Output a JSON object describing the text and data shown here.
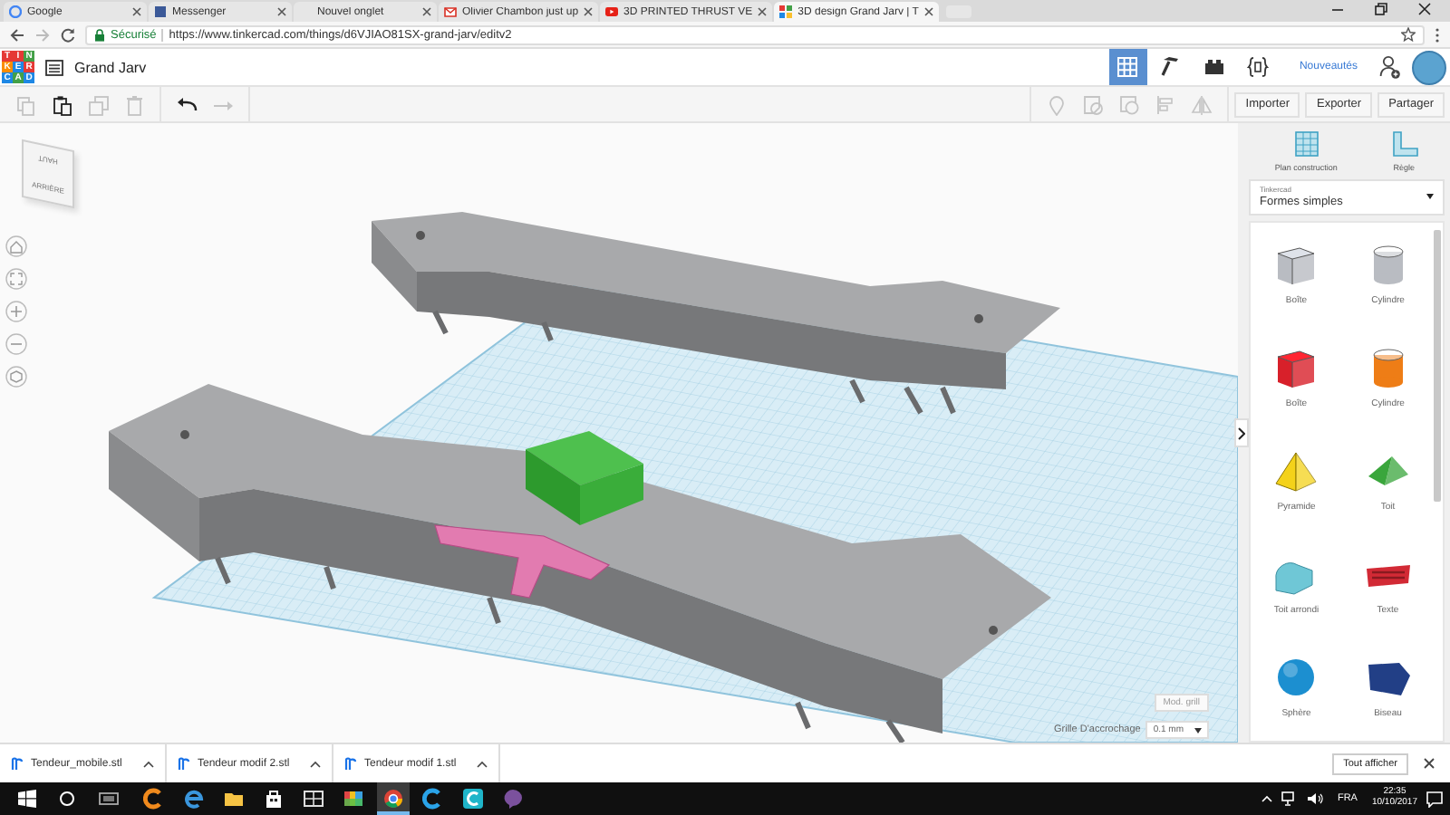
{
  "browser": {
    "tabs": [
      {
        "kind": "google",
        "title": "Google",
        "selected": false
      },
      {
        "kind": "facebook",
        "title": "Messenger",
        "selected": false
      },
      {
        "kind": "blank",
        "title": "Nouvel onglet",
        "selected": false
      },
      {
        "kind": "gmail",
        "title": "Olivier Chambon just up",
        "selected": false
      },
      {
        "kind": "youtube",
        "title": "3D PRINTED THRUST VE",
        "selected": false
      },
      {
        "kind": "tinkercad",
        "title": "3D design Grand Jarv | T",
        "selected": true
      }
    ],
    "secure_label": "Sécurisé",
    "url": "https://www.tinkercad.com/things/d6VJIAO81SX-grand-jarv/editv2"
  },
  "app_header": {
    "logo": [
      "T",
      "I",
      "N",
      "K",
      "E",
      "R",
      "C",
      "A",
      "D"
    ],
    "title": "Grand Jarv",
    "views": [
      {
        "kind": "grid",
        "selected": true
      },
      {
        "kind": "hammer",
        "selected": false
      },
      {
        "kind": "bricks",
        "selected": false
      },
      {
        "kind": "code",
        "selected": false
      }
    ],
    "news": "Nouveautés"
  },
  "toolbar": {
    "edit_tools": [
      {
        "kind": "copy",
        "disabled": true
      },
      {
        "kind": "paste",
        "disabled": false
      },
      {
        "kind": "duplicate",
        "disabled": true
      },
      {
        "kind": "delete",
        "disabled": true
      },
      {
        "kind": "undo",
        "disabled": false
      },
      {
        "kind": "redo",
        "disabled": true
      }
    ],
    "shape_tools": [
      {
        "kind": "pin",
        "disabled": true
      },
      {
        "kind": "note",
        "disabled": true
      },
      {
        "kind": "group",
        "disabled": true
      },
      {
        "kind": "align",
        "disabled": true
      },
      {
        "kind": "mirror",
        "disabled": true
      }
    ],
    "actions": [
      "Importer",
      "Exporter",
      "Partager"
    ]
  },
  "view_cube": {
    "top": "HAUT",
    "front": "ARRIÈRE"
  },
  "snap": {
    "edit_grid": "Mod. grill",
    "label": "Grille D'accrochage",
    "value": "0.1 mm"
  },
  "sidebar": {
    "tools": [
      {
        "kind": "workplane",
        "label": "Plan construction"
      },
      {
        "kind": "ruler",
        "label": "Règle"
      }
    ],
    "library": {
      "label": "Tinkercad",
      "value": "Formes simples"
    },
    "shapes": [
      {
        "kind": "box",
        "label": "Boîte",
        "color": "#b9bcc2"
      },
      {
        "kind": "cylinder",
        "label": "Cylindre",
        "color": "#b9bcc2"
      },
      {
        "kind": "box",
        "label": "Boîte",
        "color": "#d8202a"
      },
      {
        "kind": "cylinder",
        "label": "Cylindre",
        "color": "#ee7d16"
      },
      {
        "kind": "pyramid",
        "label": "Pyramide",
        "color": "#f4d21a"
      },
      {
        "kind": "roof",
        "label": "Toit",
        "color": "#3aa63c"
      },
      {
        "kind": "round-roof",
        "label": "Toit arrondi",
        "color": "#6fc7d6"
      },
      {
        "kind": "text",
        "label": "Texte",
        "color": "#d22a35"
      },
      {
        "kind": "sphere",
        "label": "Sphère",
        "color": "#1c8fd0"
      },
      {
        "kind": "wedge",
        "label": "Biseau",
        "color": "#223f86"
      }
    ]
  },
  "downloads": {
    "files": [
      "Tendeur_mobile.stl",
      "Tendeur modif 2.stl",
      "Tendeur modif 1.stl"
    ],
    "show_all": "Tout afficher"
  },
  "taskbar": {
    "apps": [
      {
        "kind": "cleaner",
        "selected": false
      },
      {
        "kind": "edge",
        "selected": false
      },
      {
        "kind": "folder",
        "selected": false
      },
      {
        "kind": "store",
        "selected": false
      },
      {
        "kind": "media",
        "selected": false
      },
      {
        "kind": "paint",
        "selected": false
      },
      {
        "kind": "chrome",
        "selected": true
      },
      {
        "kind": "c-blue",
        "selected": false
      },
      {
        "kind": "c-teal",
        "selected": false
      },
      {
        "kind": "viber",
        "selected": false
      }
    ],
    "language": "FRA",
    "time": "22:35",
    "date": "10/10/2017"
  }
}
